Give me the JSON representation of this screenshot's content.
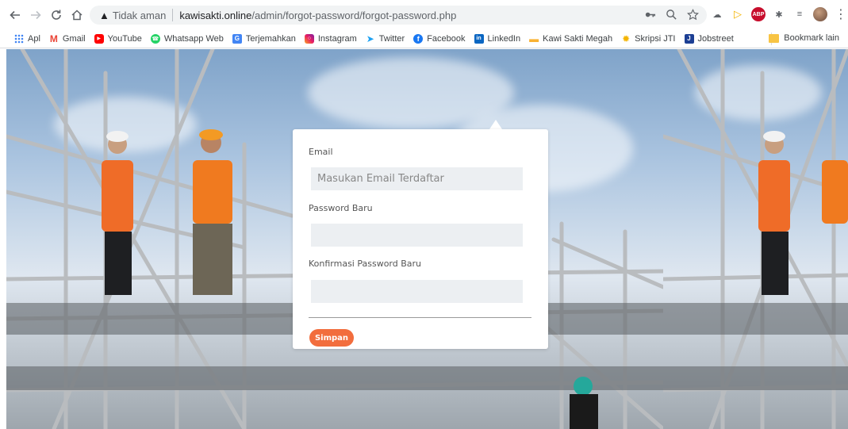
{
  "browser": {
    "security_text": "Tidak aman",
    "url_host": "kawisakti.online",
    "url_path": "/admin/forgot-password/forgot-password.php"
  },
  "bookmarks": {
    "items": [
      {
        "label": "Apl",
        "icon": "apps-grid-icon"
      },
      {
        "label": "Gmail",
        "icon": "gmail-icon"
      },
      {
        "label": "YouTube",
        "icon": "youtube-icon"
      },
      {
        "label": "Whatsapp Web",
        "icon": "whatsapp-icon"
      },
      {
        "label": "Terjemahkan",
        "icon": "translate-icon"
      },
      {
        "label": "Instagram",
        "icon": "instagram-icon"
      },
      {
        "label": "Twitter",
        "icon": "twitter-icon"
      },
      {
        "label": "Facebook",
        "icon": "facebook-icon"
      },
      {
        "label": "LinkedIn",
        "icon": "linkedin-icon"
      },
      {
        "label": "Kawi Sakti Megah",
        "icon": "kawi-icon"
      },
      {
        "label": "Skripsi JTI",
        "icon": "sun-icon"
      },
      {
        "label": "Jobstreet",
        "icon": "jobstreet-icon"
      }
    ],
    "other_label": "Bookmark lain"
  },
  "form": {
    "email_label": "Email",
    "email_placeholder": "Masukan Email Terdaftar",
    "password_label": "Password Baru",
    "confirm_label": "Konfirmasi Password Baru",
    "save_label": "Simpan"
  },
  "colors": {
    "accent": "#f26d3d",
    "input_bg": "#eceff2"
  }
}
